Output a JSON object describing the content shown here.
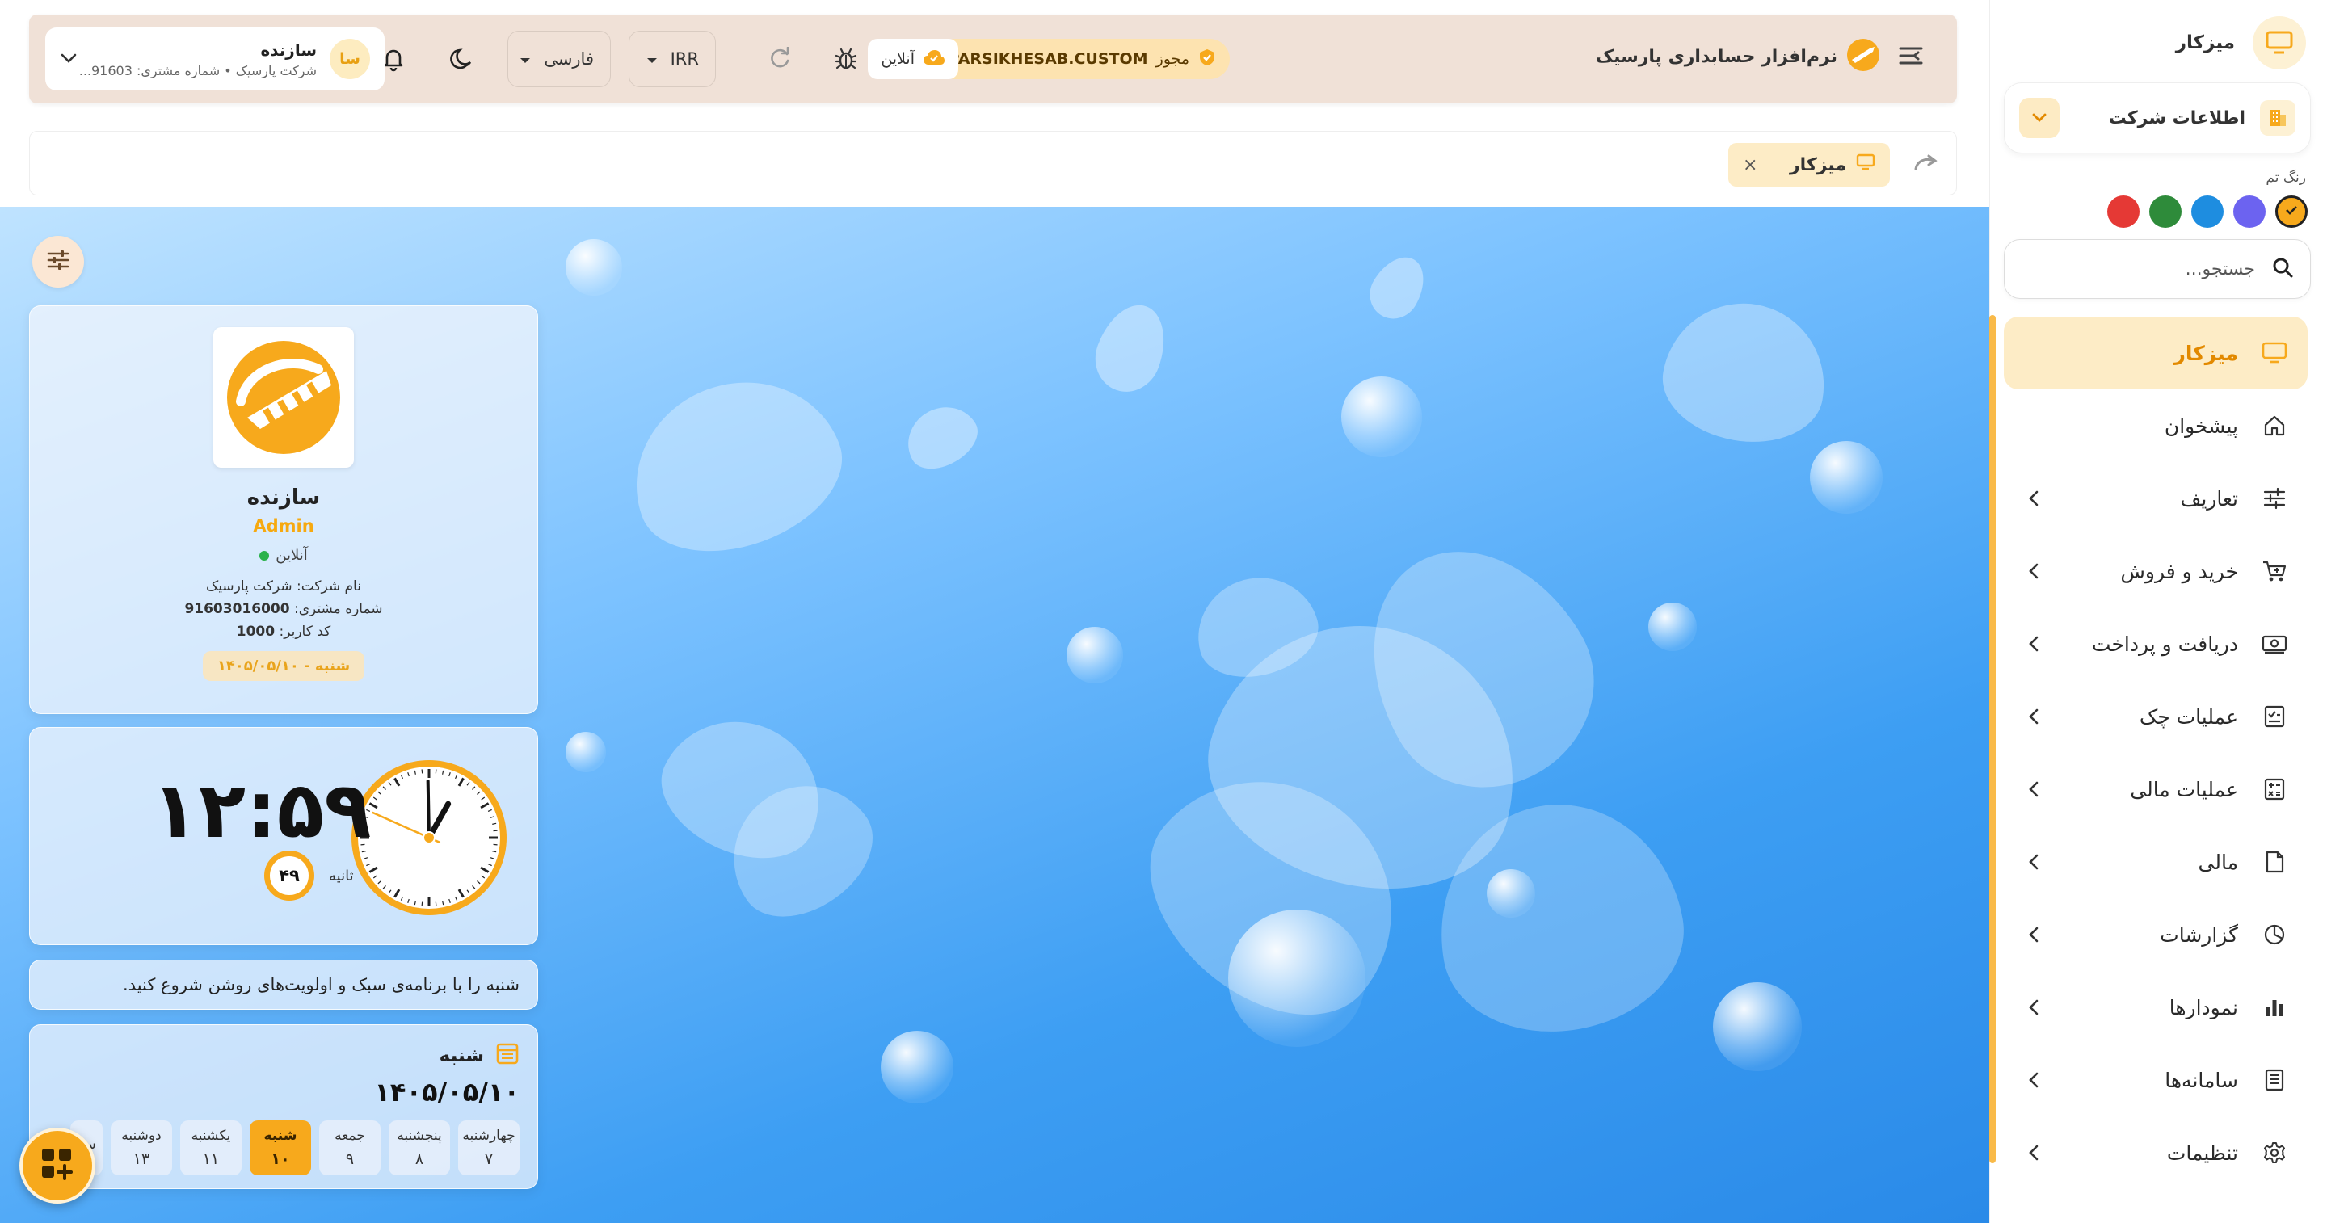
{
  "sidebar": {
    "title": "میزکار",
    "company_label": "اطلاعات شرکت",
    "theme_label": "رنگ تم",
    "theme_colors": [
      "#f7a91c",
      "#6c63f0",
      "#1e8de0",
      "#2e8b3a",
      "#e53935"
    ],
    "search_placeholder": "جستجو...",
    "items": [
      {
        "label": "میزکار",
        "icon": "monitor-icon",
        "active": true
      },
      {
        "label": "پیشخوان",
        "icon": "home-icon"
      },
      {
        "label": "تعاریف",
        "icon": "sliders-icon"
      },
      {
        "label": "خرید و فروش",
        "icon": "cart-icon"
      },
      {
        "label": "دریافت و پرداخت",
        "icon": "cash-icon"
      },
      {
        "label": "عملیات چک",
        "icon": "check-doc-icon"
      },
      {
        "label": "عملیات مالی",
        "icon": "calculator-icon"
      },
      {
        "label": "مالی",
        "icon": "document-icon"
      },
      {
        "label": "گزارشات",
        "icon": "pie-chart-icon"
      },
      {
        "label": "نمودارها",
        "icon": "bar-chart-icon"
      },
      {
        "label": "سامانه‌ها",
        "icon": "server-icon"
      },
      {
        "label": "تنظیمات",
        "icon": "gear-icon"
      }
    ]
  },
  "topbar": {
    "brand": "نرم‌افزار حسابداری پارسیک",
    "license_prefix": "مجوز",
    "license_code": "PARSIKHESAB.CUSTOM",
    "online": "آنلاین",
    "currency": "IRR",
    "language": "فارسی",
    "user_initials": "سا",
    "user_name": "سازنده",
    "user_sub": "شرکت پارسیک • شماره مشتری: 91603..."
  },
  "tabs": [
    {
      "label": "میزکار",
      "close": "×"
    }
  ],
  "profile": {
    "name": "سازنده",
    "role": "Admin",
    "status": "آنلاین",
    "company_line": "نام شرکت: شرکت پارسیک",
    "customer_prefix": "شماره مشتری:",
    "customer_no": "91603016000",
    "user_code_prefix": "کد کاربر:",
    "user_code": "1000",
    "date_line": "شنبه - ۱۴۰۵/۰۵/۱۰"
  },
  "clock": {
    "time": "۱۲:۵۹",
    "seconds": "۴۹",
    "seconds_label": "ثانیه",
    "hour": 12,
    "minute": 59,
    "second": 49
  },
  "message": "شنبه را با برنامه‌ی سبک و اولویت‌های روشن شروع کنید.",
  "calendar": {
    "weekday": "شنبه",
    "date": "۱۴۰۵/۰۵/۱۰",
    "days": [
      {
        "name": "چهارشنبه",
        "num": "۷"
      },
      {
        "name": "پنجشنبه",
        "num": "۸"
      },
      {
        "name": "جمعه",
        "num": "۹"
      },
      {
        "name": "شنبه",
        "num": "۱۰",
        "today": true
      },
      {
        "name": "یکشنبه",
        "num": "۱۱"
      },
      {
        "name": "دوشنبه",
        "num": "۱۳"
      },
      {
        "name": "سه",
        "num": ""
      }
    ]
  }
}
